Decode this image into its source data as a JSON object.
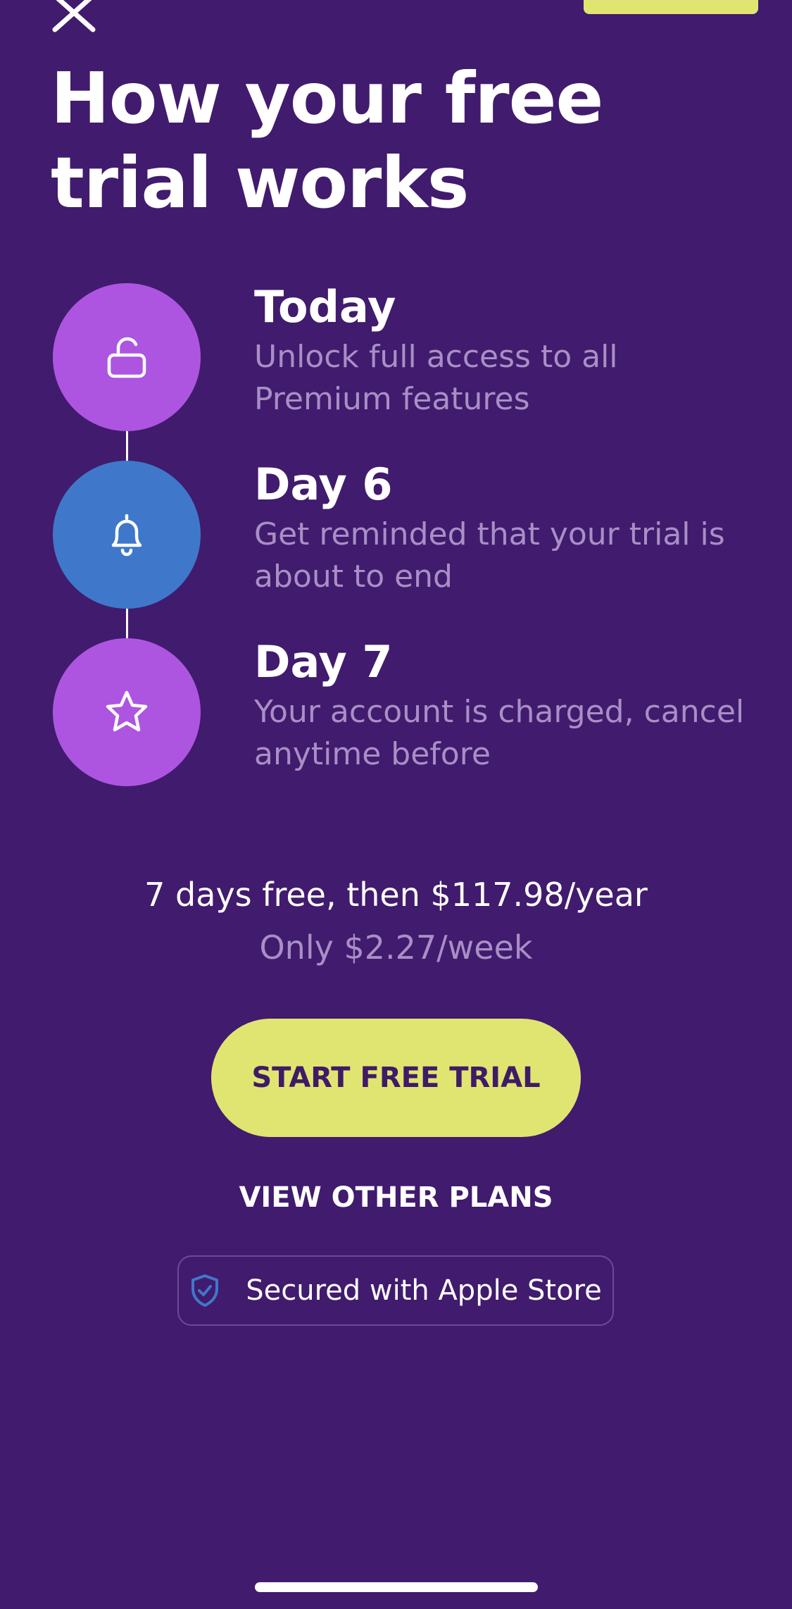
{
  "header": {
    "title": "How your free trial works"
  },
  "steps": [
    {
      "title": "Today",
      "description": "Unlock full access to all Premium features",
      "icon": "unlock-icon",
      "color": "#ad55e0"
    },
    {
      "title": "Day 6",
      "description": "Get reminded that your trial is about to end",
      "icon": "bell-icon",
      "color": "#3f78ca"
    },
    {
      "title": "Day 7",
      "description": "Your account is charged, cancel anytime before",
      "icon": "star-icon",
      "color": "#ad55e0"
    }
  ],
  "pricing": {
    "main": "7 days free, then $117.98/year",
    "sub": "Only $2.27/week"
  },
  "cta": {
    "label": "START FREE TRIAL"
  },
  "other_plans": {
    "label": "VIEW OTHER PLANS"
  },
  "secure_badge": {
    "label": "Secured with Apple Store",
    "icon": "shield-check-icon"
  },
  "colors": {
    "background": "#411b6d",
    "accent": "#e0e572",
    "muted_text": "#a88fc6"
  }
}
